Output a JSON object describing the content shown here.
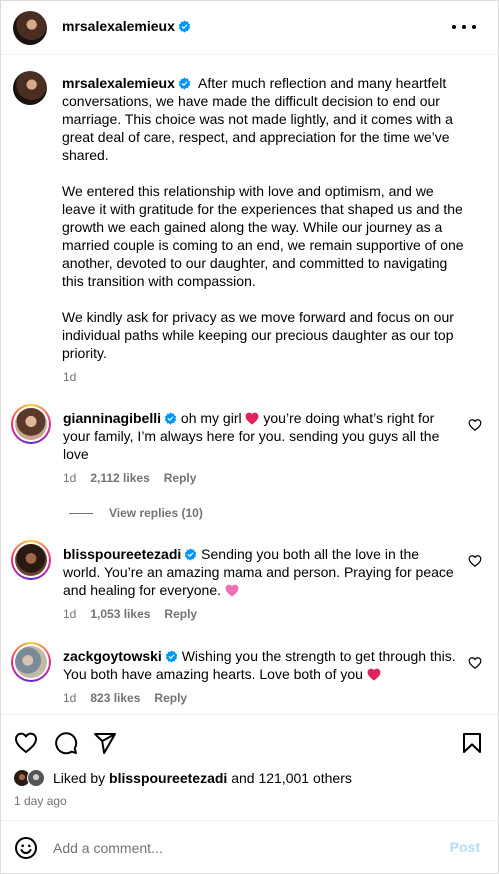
{
  "post": {
    "author": "mrsalexalemieux",
    "caption_paragraphs": [
      "After much reflection and many heartfelt conversations, we have made the difficult decision to end our marriage. This choice was not made lightly, and it comes with a great deal of care, respect, and appreciation for the time we’ve shared.",
      "We entered this relationship with love and optimism, and we leave it with gratitude for the experiences that shaped us and the growth we each gained along the way. While our journey as a married couple is coming to an end, we remain supportive of one another, devoted to our daughter, and committed to navigating this transition with compassion.",
      "We kindly ask for privacy as we move forward and focus on our individual paths while keeping our precious daughter as our top priority."
    ],
    "caption_age": "1d"
  },
  "comments": [
    {
      "user": "giannina gibelli",
      "username": "gianninagibelli",
      "text_before_heart": "oh my girl",
      "text_after_heart": "you’re doing what’s right for your family, I’m always here for you. sending you guys all the love",
      "age": "1d",
      "likes": "2,112 likes",
      "reply": "Reply",
      "view_replies": "View replies (10)"
    },
    {
      "username": "blisspoureetezadi",
      "text": "Sending you both all the love in the world. You’re an amazing mama and person. Praying for peace and healing for everyone.",
      "age": "1d",
      "likes": "1,053 likes",
      "reply": "Reply"
    },
    {
      "username": "zackgoytowski",
      "text": "Wishing you the strength to get through this. You both have amazing hearts. Love both of you",
      "age": "1d",
      "likes": "823 likes",
      "reply": "Reply"
    }
  ],
  "likes_summary": {
    "prefix": "Liked by",
    "user": "blisspoureetezadi",
    "suffix": "and 121,001 others"
  },
  "post_time": "1 day ago",
  "comment_box": {
    "placeholder": "Add a comment...",
    "post_label": "Post"
  },
  "colors": {
    "verified": "#0095f6",
    "heart_emoji": "#e0245e",
    "pink_heart_emoji": "#f06fb6",
    "muted_text": "#737373",
    "post_button_disabled": "#b3dbff"
  },
  "icons": [
    "more-options-icon",
    "verified-icon",
    "heart-icon",
    "comment-icon",
    "share-icon",
    "save-icon",
    "smile-icon"
  ]
}
